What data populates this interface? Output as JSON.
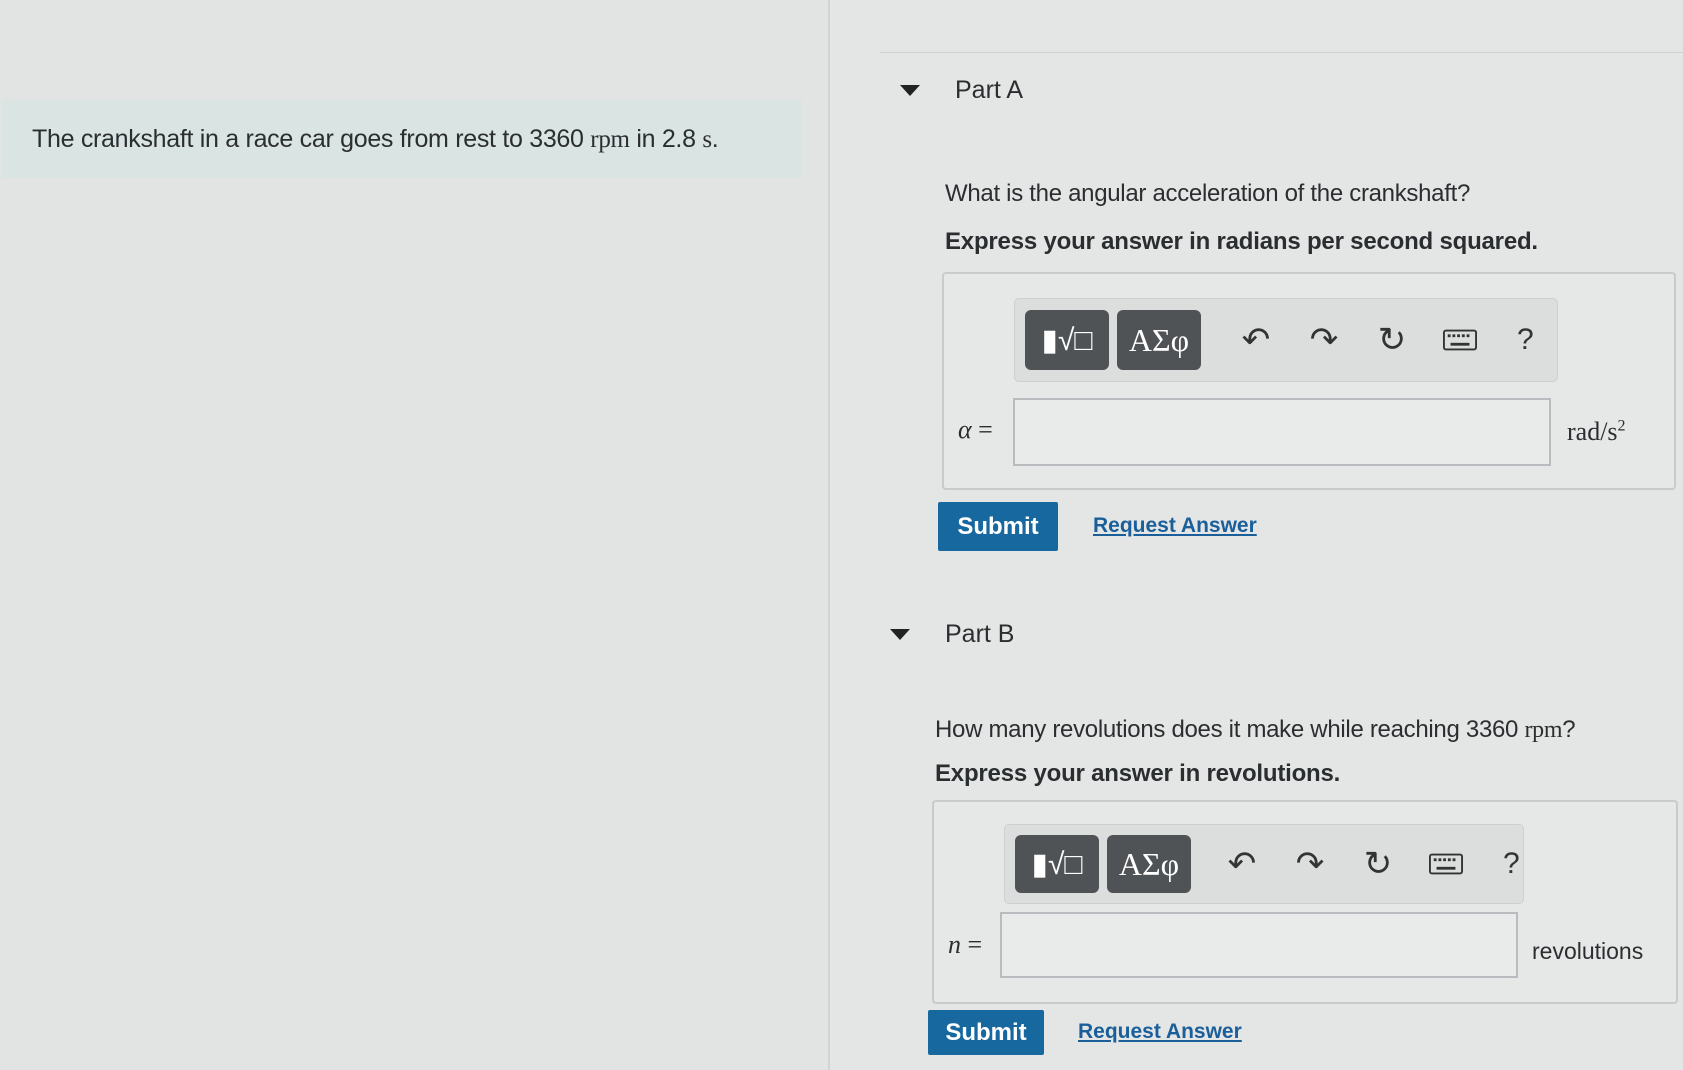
{
  "problem": {
    "text_before": "The crankshaft in a race car goes from rest to 3360 ",
    "rpm": "rpm",
    "text_mid": " in 2.8 ",
    "unit_s": "s",
    "text_end": "."
  },
  "partA": {
    "title": "Part A",
    "question": "What is the angular acceleration of the crankshaft?",
    "instruction": "Express your answer in radians per second squared.",
    "toolbar": {
      "templates": "▮√□",
      "greek": "ΑΣφ",
      "help": "?"
    },
    "variable": "α",
    "equals": " =",
    "input_value": "",
    "unit": "rad/s",
    "unit_exp": "2",
    "submit": "Submit",
    "request": "Request Answer"
  },
  "partB": {
    "title": "Part B",
    "question_before": "How many revolutions does it make while reaching 3360 ",
    "question_rpm": "rpm",
    "question_end": "?",
    "instruction": "Express your answer in revolutions.",
    "toolbar": {
      "templates": "▮√□",
      "greek": "ΑΣφ",
      "help": "?"
    },
    "variable": "n",
    "equals": " =",
    "input_value": "",
    "unit": "revolutions",
    "submit": "Submit",
    "request": "Request Answer"
  }
}
